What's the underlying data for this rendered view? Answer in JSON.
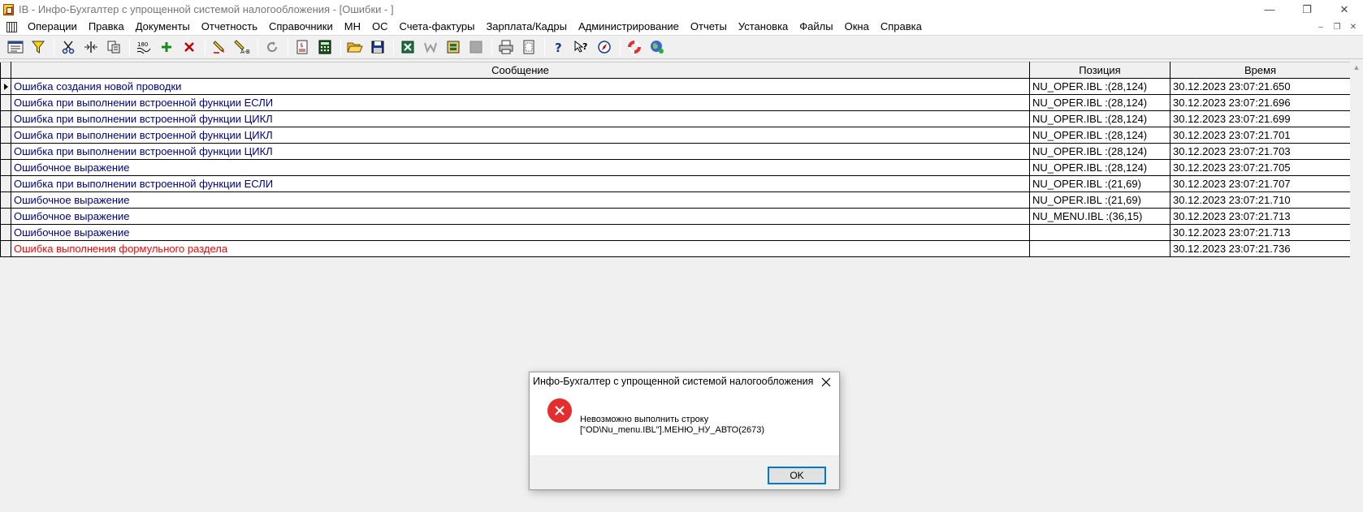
{
  "window": {
    "title": "IB - Инфо-Бухгалтер с упрощенной системой налогообложения - [Ошибки - ]",
    "minimize_glyph": "—",
    "restore_glyph": "❐",
    "close_glyph": "✕"
  },
  "menu": {
    "items": [
      "Операции",
      "Правка",
      "Документы",
      "Отчетность",
      "Справочники",
      "МН",
      "ОС",
      "Счета-фактуры",
      "Зарплата/Кадры",
      "Администрирование",
      "Отчеты",
      "Установка",
      "Файлы",
      "Окна",
      "Справка"
    ],
    "mdi_minimize": "–",
    "mdi_restore": "❐",
    "mdi_close": "✕"
  },
  "toolbar": {
    "icons": [
      "grid-view-icon",
      "filter-icon",
      "cut-icon",
      "split-icon",
      "copy-doc-icon",
      "number-sort-icon",
      "add-icon",
      "delete-icon",
      "edit-icon",
      "replace-icon",
      "refresh-icon",
      "report-icon",
      "calculator-icon",
      "open-folder-icon",
      "save-icon",
      "excel-icon",
      "word-icon",
      "table-icon",
      "gray-box-icon",
      "print-icon",
      "preview-icon",
      "help-icon",
      "context-help-icon",
      "compass-icon",
      "lifebuoy-icon",
      "globe-icon"
    ]
  },
  "grid": {
    "columns": {
      "message": "Сообщение",
      "position": "Позиция",
      "time": "Время"
    },
    "rows": [
      {
        "message": "Ошибка создания новой проводки",
        "position": "NU_OPER.IBL :(28,124)",
        "time": "30.12.2023 23:07:21.650",
        "status": "blue",
        "current": true
      },
      {
        "message": "Ошибка при выполнении встроенной функции ЕСЛИ",
        "position": "NU_OPER.IBL :(28,124)",
        "time": "30.12.2023 23:07:21.696",
        "status": "blue"
      },
      {
        "message": "Ошибка при выполнении встроенной функции ЦИКЛ",
        "position": "NU_OPER.IBL :(28,124)",
        "time": "30.12.2023 23:07:21.699",
        "status": "blue"
      },
      {
        "message": "Ошибка при выполнении встроенной функции ЦИКЛ",
        "position": "NU_OPER.IBL :(28,124)",
        "time": "30.12.2023 23:07:21.701",
        "status": "blue"
      },
      {
        "message": "Ошибка при выполнении встроенной функции ЦИКЛ",
        "position": "NU_OPER.IBL :(28,124)",
        "time": "30.12.2023 23:07:21.703",
        "status": "blue"
      },
      {
        "message": "Ошибочное выражение",
        "position": "NU_OPER.IBL :(28,124)",
        "time": "30.12.2023 23:07:21.705",
        "status": "blue"
      },
      {
        "message": "Ошибка при выполнении встроенной функции ЕСЛИ",
        "position": "NU_OPER.IBL :(21,69)",
        "time": "30.12.2023 23:07:21.707",
        "status": "blue"
      },
      {
        "message": "Ошибочное выражение",
        "position": "NU_OPER.IBL :(21,69)",
        "time": "30.12.2023 23:07:21.710",
        "status": "blue"
      },
      {
        "message": "Ошибочное выражение",
        "position": "NU_MENU.IBL :(36,15)",
        "time": "30.12.2023 23:07:21.713",
        "status": "blue"
      },
      {
        "message": "Ошибочное выражение",
        "position": "",
        "time": "30.12.2023 23:07:21.713",
        "status": "blue"
      },
      {
        "message": "Ошибка выполнения формульного раздела",
        "position": "",
        "time": "30.12.2023 23:07:21.736",
        "status": "red"
      }
    ],
    "scroll_up_glyph": "▲"
  },
  "dialog": {
    "title": "Инфо-Бухгалтер с упрощенной системой налогообложения",
    "message_line1": "Невозможно выполнить строку",
    "message_line2": "[\"OD\\Nu_menu.IBL\"].МЕНЮ_НУ_АВТО(2673)",
    "ok_label": "OK",
    "close_glyph": "✕"
  },
  "colors": {
    "message_blue": "#00008b",
    "message_red": "#ff0000",
    "ok_focus": "#0078d7",
    "error_icon": "#e52d2d"
  }
}
